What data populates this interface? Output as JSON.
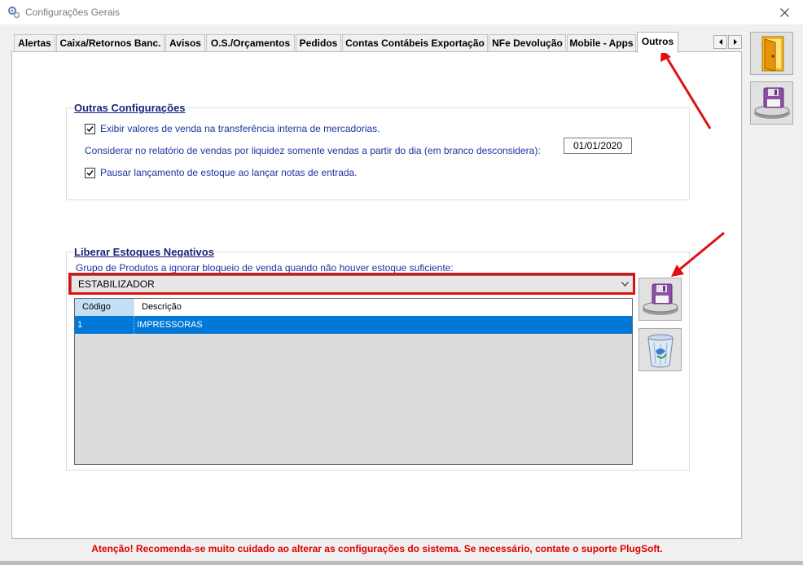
{
  "window": {
    "title": "Configurações Gerais"
  },
  "tabs": [
    {
      "label": "Alertas"
    },
    {
      "label": "Caixa/Retornos Banc."
    },
    {
      "label": "Avisos"
    },
    {
      "label": "O.S./Orçamentos"
    },
    {
      "label": "Pedidos"
    },
    {
      "label": "Contas Contábeis Exportação"
    },
    {
      "label": "NFe Devolução"
    },
    {
      "label": "Mobile - Apps"
    },
    {
      "label": "Outros",
      "active": true
    }
  ],
  "outras": {
    "title": "Outras Configurações",
    "check1": {
      "label": "Exibir valores de venda na transferência interna de mercadorias.",
      "checked": true
    },
    "date_label": "Considerar no relatório de vendas por liquidez somente vendas a partir do dia (em branco desconsidera):",
    "date_value": "01/01/2020",
    "check2": {
      "label": "Pausar lançamento de estoque ao lançar notas de entrada.",
      "checked": true
    }
  },
  "liberar": {
    "title": "Liberar Estoques Negativos",
    "group_label": "Grupo de Produtos a ignorar bloqueio de venda quando não houver estoque suficiente:",
    "combo_value": "ESTABILIZADOR",
    "columns": [
      "Código",
      "Descrição"
    ],
    "rows": [
      {
        "codigo": "1",
        "descricao": "IMPRESSORAS"
      }
    ]
  },
  "side_buttons": {
    "exit_icon": "door-exit-icon",
    "save_icon": "floppy-save-icon"
  },
  "warning": "Atenção! Recomenda-se muito cuidado ao alterar as configurações do sistema. Se necessário, contate o suporte PlugSoft.",
  "colors": {
    "accent_red": "#e01010",
    "label_blue": "#1a35a0",
    "selection": "#0078d7"
  }
}
